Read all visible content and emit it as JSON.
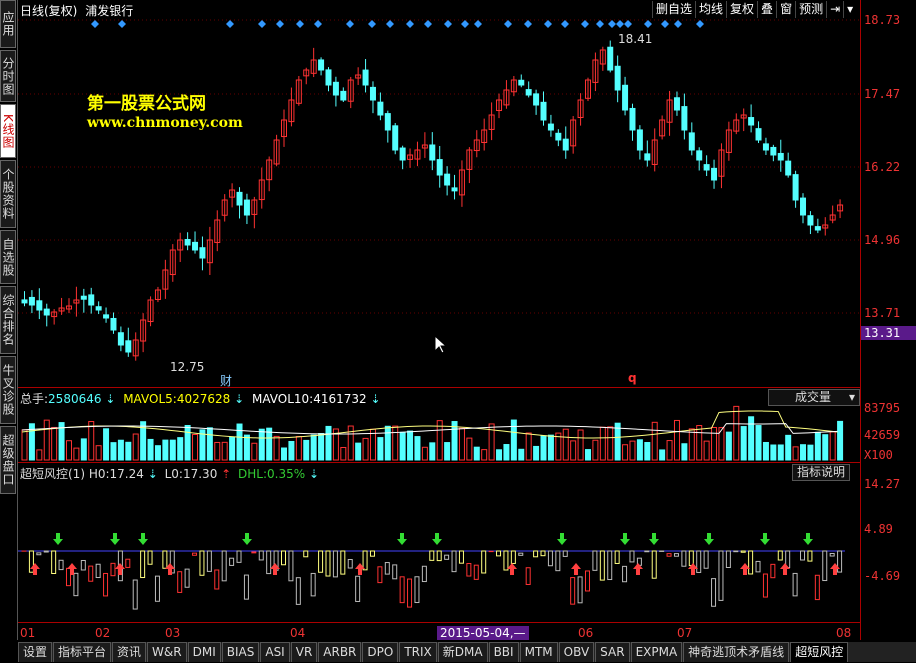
{
  "sidebar": {
    "tabs": [
      {
        "label": "应用",
        "active": false
      },
      {
        "label": "分时图",
        "active": false
      },
      {
        "label": "K线图",
        "active": true
      },
      {
        "label": "个股资料",
        "active": false
      },
      {
        "label": "自选股",
        "active": false
      },
      {
        "label": "综合排名",
        "active": false
      },
      {
        "label": "牛叉诊股",
        "active": false
      },
      {
        "label": "超级盘口",
        "active": false
      }
    ]
  },
  "header": {
    "period": "日线(复权)",
    "stock": "浦发银行"
  },
  "toolbar": {
    "items": [
      "删自选",
      "均线",
      "复权",
      "叠",
      "窗",
      "预测"
    ]
  },
  "watermark": {
    "line1": "第一股票公式网",
    "line2": "www.chnmoney.com"
  },
  "price_axis": {
    "labels": [
      "18.73",
      "17.47",
      "16.22",
      "14.96",
      "13.71"
    ],
    "current": "13.31"
  },
  "price_chart": {
    "high_label": "18.41",
    "low_label": "12.75",
    "event_label": "财",
    "q_label": "q"
  },
  "volume_panel": {
    "title": "总手:",
    "total": "2580646",
    "mavol5_label": "MAVOL5:",
    "mavol5": "4027628",
    "mavol10_label": "MAVOL10:",
    "mavol10": "4161732",
    "dropdown": "成交量",
    "axis": [
      "83795",
      "42659",
      "X100"
    ]
  },
  "indicator_panel": {
    "name": "超短风控(1)",
    "h0_label": "H0:",
    "h0": "17.24",
    "l0_label": "L0:",
    "l0": "17.30",
    "dhl_label": "DHL:",
    "dhl": "0.35%",
    "help_button": "指标说明",
    "axis": [
      "14.27",
      "4.89",
      "-4.69"
    ]
  },
  "x_axis": {
    "labels": [
      "01",
      "02",
      "03",
      "04",
      "06",
      "07",
      "08"
    ],
    "cursor_date": "2015-05-04,—"
  },
  "bottom_tabs": [
    "设置",
    "指标平台",
    "资讯",
    "W&R",
    "DMI",
    "BIAS",
    "ASI",
    "VR",
    "ARBR",
    "DPO",
    "TRIX",
    "新DMA",
    "BBI",
    "MTM",
    "OBV",
    "SAR",
    "EXPMA",
    "神奇逃顶术矛盾线",
    "超短风控"
  ],
  "active_bottom_tab": "超短风控",
  "colors": {
    "up": "#ff3232",
    "down": "#54ffff",
    "axis": "#aa0000",
    "yellow": "#ffff00",
    "green": "#00dd00"
  }
}
